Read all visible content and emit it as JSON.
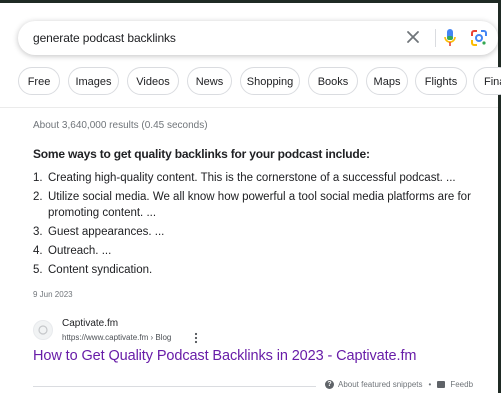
{
  "search": {
    "query": "generate podcast backlinks"
  },
  "chips": [
    {
      "label": "Free"
    },
    {
      "label": "Images"
    },
    {
      "label": "Videos"
    },
    {
      "label": "News"
    },
    {
      "label": "Shopping"
    },
    {
      "label": "Books"
    },
    {
      "label": "Maps"
    },
    {
      "label": "Flights"
    },
    {
      "label": "Fina"
    }
  ],
  "results": {
    "stats": "About 3,640,000 results (0.45 seconds)"
  },
  "snippet": {
    "heading": "Some ways to get quality backlinks for your podcast include:",
    "items": [
      {
        "num": "1.",
        "line1": "Creating high-quality content. This is the cornerstone of a successful podcast. ...",
        "line2": ""
      },
      {
        "num": "2.",
        "line1": "Utilize social media. We all know how powerful a tool social media platforms are for",
        "line2": "promoting content. ..."
      },
      {
        "num": "3.",
        "line1": "Guest appearances. ...",
        "line2": ""
      },
      {
        "num": "4.",
        "line1": "Outreach. ...",
        "line2": ""
      },
      {
        "num": "5.",
        "line1": "Content syndication.",
        "line2": ""
      }
    ],
    "date": "9 Jun 2023",
    "source": {
      "name": "Captivate.fm",
      "url": "https://www.captivate.fm › Blog"
    },
    "title": "How to Get Quality Podcast Backlinks in 2023 - Captivate.fm"
  },
  "footer": {
    "about": "About featured snippets",
    "separator": "•",
    "feedback": "Feedb"
  },
  "colors": {
    "link_visited": "#681da8",
    "mic_blue": "#4285f4",
    "mic_red": "#ea4335"
  }
}
